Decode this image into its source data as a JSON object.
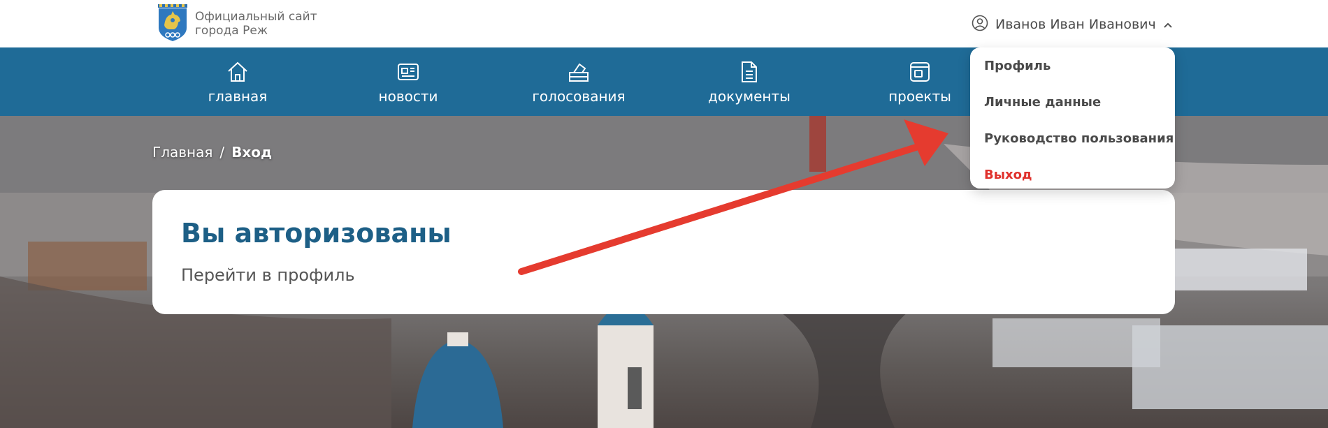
{
  "header": {
    "logo_text_line1": "Официальный сайт",
    "logo_text_line2": "города Реж",
    "user_name": "Иванов Иван Иванович"
  },
  "nav": {
    "items": [
      {
        "label": "главная",
        "icon": "home-icon"
      },
      {
        "label": "новости",
        "icon": "newspaper-icon"
      },
      {
        "label": "голосования",
        "icon": "ballot-box-icon"
      },
      {
        "label": "документы",
        "icon": "document-icon"
      },
      {
        "label": "проекты",
        "icon": "projects-icon"
      }
    ]
  },
  "breadcrumb": {
    "home": "Главная",
    "separator": "/",
    "current": "Вход"
  },
  "card": {
    "title": "Вы авторизованы",
    "link": "Перейти в профиль"
  },
  "user_menu": {
    "items": [
      {
        "label": "Профиль"
      },
      {
        "label": "Личные данные"
      },
      {
        "label": "Руководство пользования"
      },
      {
        "label": "Выход"
      }
    ]
  },
  "colors": {
    "nav_background": "#1f6b97",
    "title": "#1d5f86",
    "logout": "#e0312c",
    "arrow": "#e53b2f"
  }
}
